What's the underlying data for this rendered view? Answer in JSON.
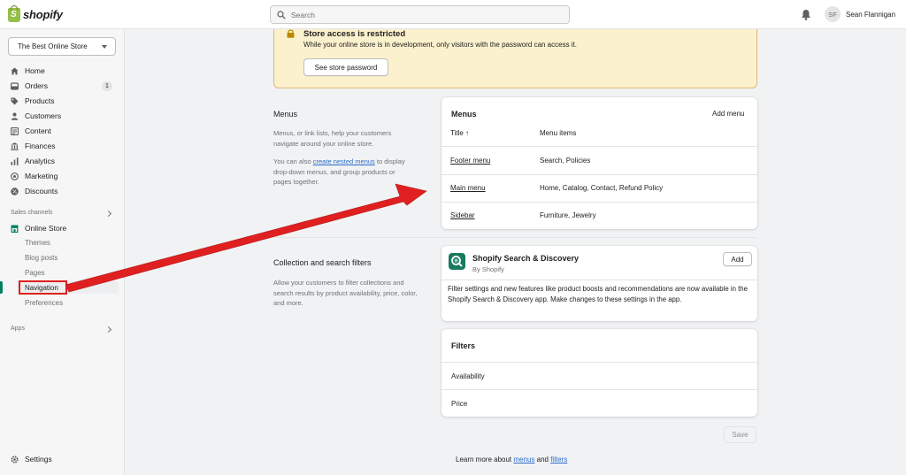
{
  "topbar": {
    "logo_text": "shopify",
    "search_placeholder": "Search",
    "user_initials": "SF",
    "user_name": "Sean Flannigan"
  },
  "sidebar": {
    "store_name": "The Best Online Store",
    "items": [
      {
        "label": "Home",
        "icon": "home-icon"
      },
      {
        "label": "Orders",
        "icon": "orders-icon",
        "badge": "1"
      },
      {
        "label": "Products",
        "icon": "tag-icon"
      },
      {
        "label": "Customers",
        "icon": "person-icon"
      },
      {
        "label": "Content",
        "icon": "content-icon"
      },
      {
        "label": "Finances",
        "icon": "bank-icon"
      },
      {
        "label": "Analytics",
        "icon": "bar-chart-icon"
      },
      {
        "label": "Marketing",
        "icon": "target-icon"
      },
      {
        "label": "Discounts",
        "icon": "discount-icon"
      }
    ],
    "sales_channels_label": "Sales channels",
    "online_store_label": "Online Store",
    "sub_items": [
      "Themes",
      "Blog posts",
      "Pages",
      "Navigation",
      "Preferences"
    ],
    "apps_label": "Apps",
    "settings_label": "Settings"
  },
  "banner": {
    "title": "Store access is restricted",
    "text": "While your online store is in development, only visitors with the password can access it.",
    "button": "See store password"
  },
  "menus_section": {
    "title": "Menus",
    "desc1": "Menus, or link lists, help your customers navigate around your online store.",
    "desc2_pre": "You can also ",
    "desc2_link": "create nested menus",
    "desc2_post": " to display drop-down menus, and group products or pages together."
  },
  "menus_card": {
    "title": "Menus",
    "add_link": "Add menu",
    "col_title": "Title ↑",
    "col_items": "Menu items",
    "rows": [
      {
        "title": "Footer menu",
        "items": "Search, Policies"
      },
      {
        "title": "Main menu",
        "items": "Home, Catalog, Contact, Refund Policy"
      },
      {
        "title": "Sidebar",
        "items": "Furniture, Jewelry"
      }
    ]
  },
  "filters_section": {
    "title": "Collection and search filters",
    "desc": "Allow your customers to filter collections and search results by product availability, price, color, and more."
  },
  "app_card": {
    "name": "Shopify Search & Discovery",
    "by": "By Shopify",
    "button": "Add",
    "desc": "Filter settings and new features like product boosts and recommendations are now available in the Shopify Search & Discovery app. Make changes to these settings in the app."
  },
  "filters_card": {
    "title": "Filters",
    "rows": [
      "Availability",
      "Price"
    ]
  },
  "footer": {
    "save": "Save",
    "learn_pre": "Learn more about ",
    "learn_menus": "menus",
    "learn_and": " and ",
    "learn_filters": "filters"
  },
  "colors": {
    "accent_green": "#008060",
    "link_blue": "#2c6ecb",
    "banner_bg": "#fcf1cd",
    "annotation_red": "#e02020"
  }
}
